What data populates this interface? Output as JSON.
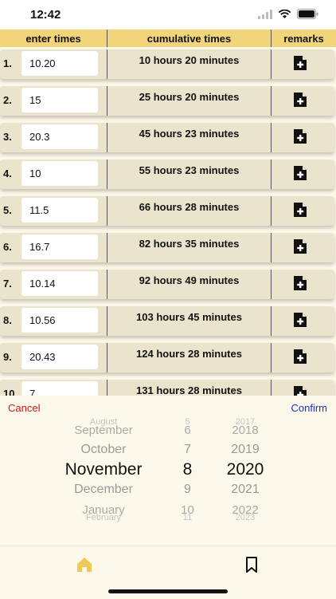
{
  "status_bar": {
    "time": "12:42"
  },
  "table": {
    "headers": {
      "enter_times": "enter times",
      "cumulative_times": "cumulative times",
      "remarks": "remarks"
    },
    "rows": [
      {
        "index": "1.",
        "value": "10.20",
        "cumulative": "10 hours 20 minutes"
      },
      {
        "index": "2.",
        "value": "15",
        "cumulative": "25 hours 20 minutes"
      },
      {
        "index": "3.",
        "value": "20.3",
        "cumulative": "45 hours 23 minutes"
      },
      {
        "index": "4.",
        "value": "10",
        "cumulative": "55 hours 23 minutes"
      },
      {
        "index": "5.",
        "value": "11.5",
        "cumulative": "66 hours 28 minutes"
      },
      {
        "index": "6.",
        "value": "16.7",
        "cumulative": "82 hours 35 minutes"
      },
      {
        "index": "7.",
        "value": "10.14",
        "cumulative": "92 hours 49 minutes"
      },
      {
        "index": "8.",
        "value": "10.56",
        "cumulative": "103 hours 45 minutes"
      },
      {
        "index": "9.",
        "value": "20.43",
        "cumulative": "124 hours 28 minutes"
      },
      {
        "index": "10.",
        "value": "7",
        "cumulative": "131 hours 28 minutes"
      }
    ],
    "remark_icon": "add-document-icon"
  },
  "date_picker": {
    "cancel_label": "Cancel",
    "confirm_label": "Confirm",
    "months": [
      "August",
      "September",
      "October",
      "November",
      "December",
      "January",
      "February"
    ],
    "days": [
      "5",
      "6",
      "7",
      "8",
      "9",
      "10",
      "11"
    ],
    "years": [
      "2017",
      "2018",
      "2019",
      "2020",
      "2021",
      "2022",
      "2023"
    ],
    "selected": {
      "month": "November",
      "day": "8",
      "year": "2020"
    }
  },
  "tab_bar": {
    "tabs": [
      {
        "icon": "home-icon",
        "active": true
      },
      {
        "icon": "bookmark-icon",
        "active": false
      }
    ],
    "active_color": "#f0c85a"
  },
  "colors": {
    "header_bg": "#f2d47a",
    "row_bg": "#ebe4cc",
    "cancel": "#d01616",
    "confirm": "#1a2fd4"
  }
}
